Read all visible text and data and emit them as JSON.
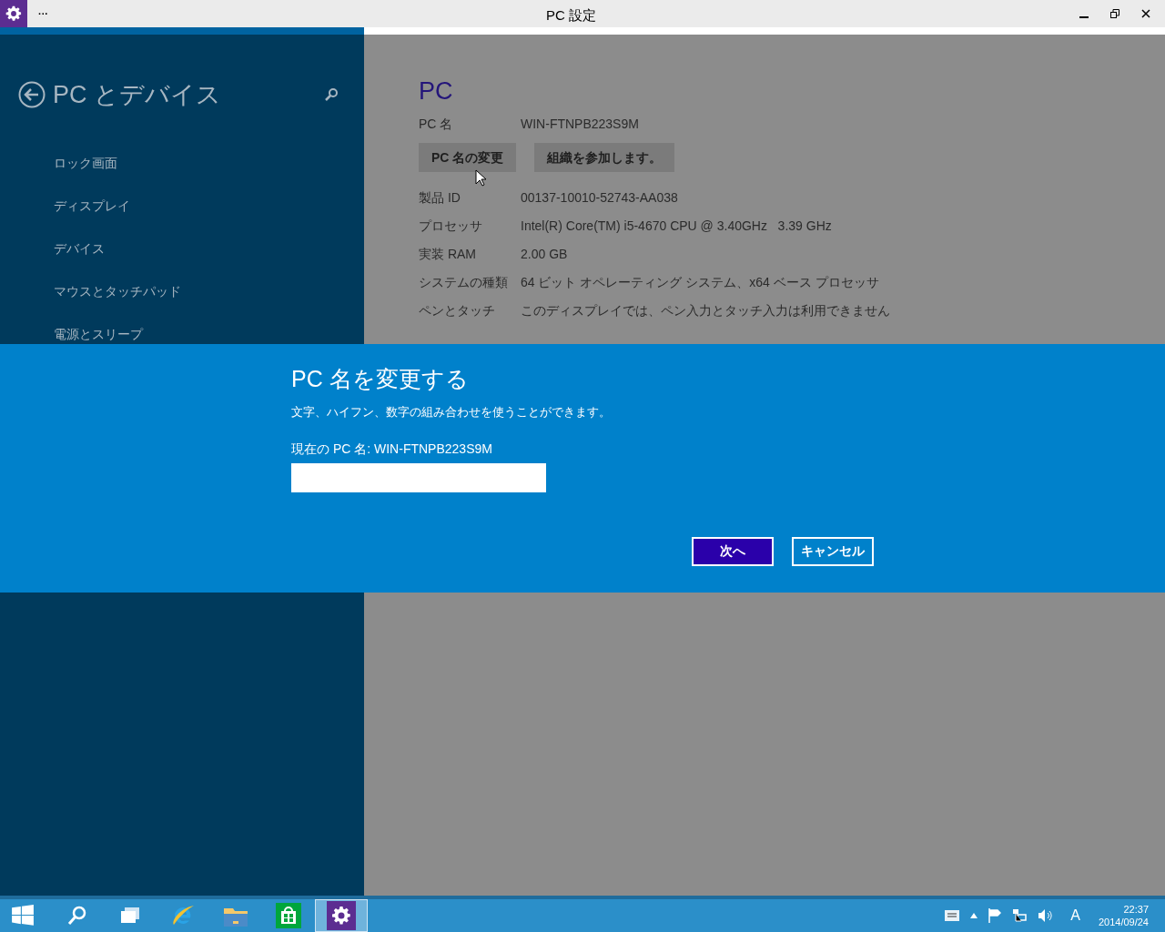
{
  "window": {
    "title": "PC 設定",
    "menu": "···"
  },
  "sidebar": {
    "title": "PC とデバイス",
    "items": [
      {
        "label": "ロック画面"
      },
      {
        "label": "ディスプレイ"
      },
      {
        "label": "デバイス"
      },
      {
        "label": "マウスとタッチパッド"
      },
      {
        "label": "電源とスリープ"
      }
    ]
  },
  "content": {
    "heading": "PC",
    "pc_name": {
      "label": "PC 名",
      "value": "WIN-FTNPB223S9M"
    },
    "buttons": [
      "PC 名の変更",
      "組織を参加します。"
    ],
    "specs": [
      {
        "label": "製品 ID",
        "value": "00137-10010-52743-AA038"
      },
      {
        "label": "プロセッサ",
        "value": "Intel(R) Core(TM) i5-4670 CPU @ 3.40GHz   3.39 GHz"
      },
      {
        "label": "実装 RAM",
        "value": "2.00 GB"
      },
      {
        "label": "システムの種類",
        "value": "64 ビット オペレーティング システム、x64 ベース プロセッサ"
      },
      {
        "label": "ペンとタッチ",
        "value": "このディスプレイでは、ペン入力とタッチ入力は利用できません"
      }
    ]
  },
  "dialog": {
    "title": "PC 名を変更する",
    "description": "文字、ハイフン、数字の組み合わせを使うことができます。",
    "current": "現在の PC 名: WIN-FTNPB223S9M",
    "buttons": [
      {
        "label": "次へ",
        "kind": "primary"
      },
      {
        "label": "キャンセル",
        "kind": "secondary"
      }
    ]
  },
  "taskbar": {
    "apps": [
      {
        "kind": "search",
        "selected": false
      },
      {
        "kind": "tasks",
        "selected": false
      },
      {
        "kind": "browser",
        "selected": false
      },
      {
        "kind": "folder",
        "selected": false
      },
      {
        "kind": "store",
        "selected": false
      },
      {
        "kind": "settings",
        "selected": true
      }
    ],
    "tray": {
      "ime": "A",
      "time": "22:37",
      "date": "2014/09/24"
    }
  }
}
